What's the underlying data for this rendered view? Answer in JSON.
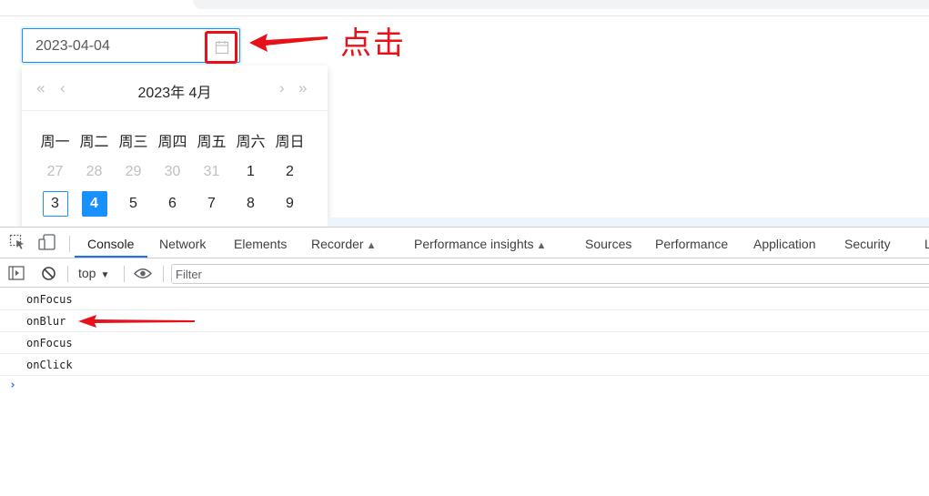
{
  "date_picker": {
    "value": "2023-04-04",
    "icon": "calendar-icon",
    "annotation_text": "点击",
    "calendar": {
      "title": "2023年  4月",
      "prev_year": "«",
      "prev_month": "‹",
      "next_month": "›",
      "next_year": "»",
      "weekdays": [
        "周一",
        "周二",
        "周三",
        "周四",
        "周五",
        "周六",
        "周日"
      ],
      "rows": [
        [
          "27",
          "28",
          "29",
          "30",
          "31",
          "1",
          "2"
        ],
        [
          "3",
          "4",
          "5",
          "6",
          "7",
          "8",
          "9"
        ]
      ],
      "today": "3",
      "selected": "4"
    }
  },
  "devtools": {
    "tabs": {
      "console": "Console",
      "network": "Network",
      "elements": "Elements",
      "recorder": "Recorder",
      "performance_insights": "Performance insights",
      "sources": "Sources",
      "performance": "Performance",
      "application": "Application",
      "security": "Security",
      "lighthouse": "L"
    },
    "toolbar": {
      "context": "top",
      "filter_placeholder": "Filter"
    },
    "logs": [
      "onFocus",
      "onBlur",
      "onFocus",
      "onClick"
    ],
    "prompt": "›"
  },
  "colors": {
    "accent": "#1890ff",
    "annotation": "#e8111a",
    "devtools_active": "#1a73e8"
  }
}
